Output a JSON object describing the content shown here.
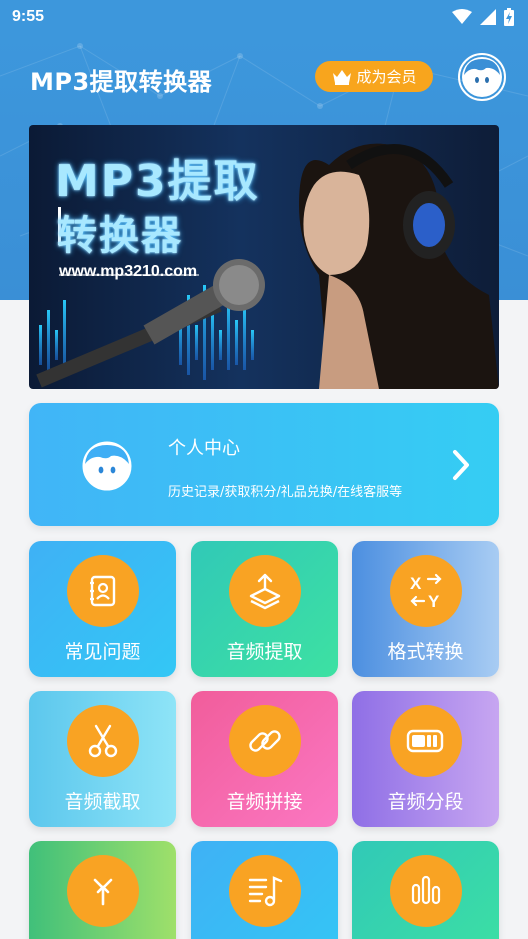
{
  "status_bar": {
    "time": "9:55"
  },
  "header": {
    "app_title": "MP3提取转换器",
    "vip_label": "成为会员"
  },
  "banner": {
    "title_line1": "MP3提取",
    "title_line2": "转换器",
    "url": "www.mp3210.com"
  },
  "personal_center": {
    "title": "个人中心",
    "description": "历史记录/获取积分/礼品兑换/在线客服等"
  },
  "tiles": [
    {
      "label": "常见问题",
      "icon": "document-icon"
    },
    {
      "label": "音频提取",
      "icon": "layers-upload-icon"
    },
    {
      "label": "格式转换",
      "icon": "swap-xy-icon"
    },
    {
      "label": "音频截取",
      "icon": "scissors-icon"
    },
    {
      "label": "音频拼接",
      "icon": "link-icon"
    },
    {
      "label": "音频分段",
      "icon": "battery-segment-icon"
    },
    {
      "label": "",
      "icon": "merge-arrow-icon"
    },
    {
      "label": "",
      "icon": "music-list-icon"
    },
    {
      "label": "",
      "icon": "equalizer-icon"
    }
  ],
  "colors": {
    "header_blue": "#3d97dc",
    "vip_orange": "#f8a51d",
    "icon_orange": "#f9a323",
    "card_blue": "#41b5f7"
  }
}
